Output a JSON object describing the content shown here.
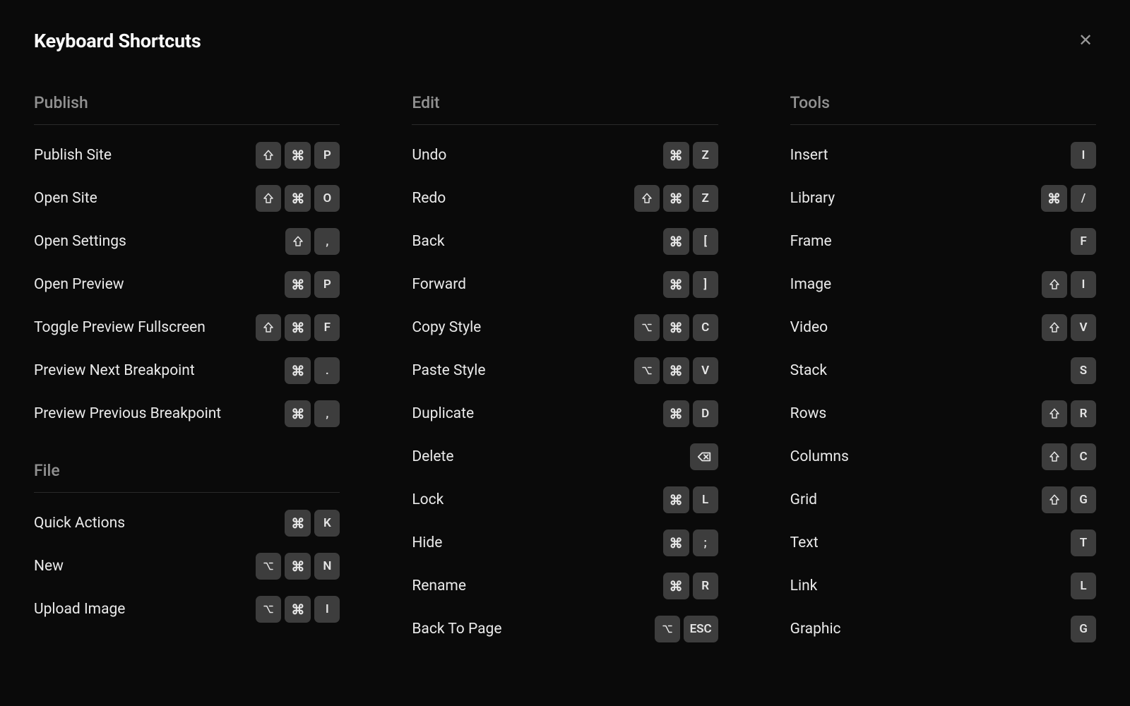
{
  "title": "Keyboard Shortcuts",
  "symbols": {
    "shift": "⇧",
    "cmd": "⌘",
    "option": "⌥"
  },
  "columns": [
    {
      "sections": [
        {
          "title": "Publish",
          "items": [
            {
              "label": "Publish Site",
              "keys": [
                "shift",
                "cmd",
                "P"
              ]
            },
            {
              "label": "Open Site",
              "keys": [
                "shift",
                "cmd",
                "O"
              ]
            },
            {
              "label": "Open Settings",
              "keys": [
                "shift",
                ","
              ]
            },
            {
              "label": "Open Preview",
              "keys": [
                "cmd",
                "P"
              ]
            },
            {
              "label": "Toggle Preview Fullscreen",
              "keys": [
                "shift",
                "cmd",
                "F"
              ]
            },
            {
              "label": "Preview Next Breakpoint",
              "keys": [
                "cmd",
                "."
              ]
            },
            {
              "label": "Preview Previous Breakpoint",
              "keys": [
                "cmd",
                ","
              ]
            }
          ]
        },
        {
          "title": "File",
          "items": [
            {
              "label": "Quick Actions",
              "keys": [
                "cmd",
                "K"
              ]
            },
            {
              "label": "New",
              "keys": [
                "option",
                "cmd",
                "N"
              ]
            },
            {
              "label": "Upload Image",
              "keys": [
                "option",
                "cmd",
                "I"
              ]
            }
          ]
        }
      ]
    },
    {
      "sections": [
        {
          "title": "Edit",
          "items": [
            {
              "label": "Undo",
              "keys": [
                "cmd",
                "Z"
              ]
            },
            {
              "label": "Redo",
              "keys": [
                "shift",
                "cmd",
                "Z"
              ]
            },
            {
              "label": "Back",
              "keys": [
                "cmd",
                "["
              ]
            },
            {
              "label": "Forward",
              "keys": [
                "cmd",
                "]"
              ]
            },
            {
              "label": "Copy Style",
              "keys": [
                "option",
                "cmd",
                "C"
              ]
            },
            {
              "label": "Paste Style",
              "keys": [
                "option",
                "cmd",
                "V"
              ]
            },
            {
              "label": "Duplicate",
              "keys": [
                "cmd",
                "D"
              ]
            },
            {
              "label": "Delete",
              "keys": [
                "backspace"
              ]
            },
            {
              "label": "Lock",
              "keys": [
                "cmd",
                "L"
              ]
            },
            {
              "label": "Hide",
              "keys": [
                "cmd",
                ";"
              ]
            },
            {
              "label": "Rename",
              "keys": [
                "cmd",
                "R"
              ]
            },
            {
              "label": "Back To Page",
              "keys": [
                "option",
                "ESC"
              ]
            }
          ]
        }
      ]
    },
    {
      "sections": [
        {
          "title": "Tools",
          "items": [
            {
              "label": "Insert",
              "keys": [
                "I"
              ]
            },
            {
              "label": "Library",
              "keys": [
                "cmd",
                "/"
              ]
            },
            {
              "label": "Frame",
              "keys": [
                "F"
              ]
            },
            {
              "label": "Image",
              "keys": [
                "shift",
                "I"
              ]
            },
            {
              "label": "Video",
              "keys": [
                "shift",
                "V"
              ]
            },
            {
              "label": "Stack",
              "keys": [
                "S"
              ]
            },
            {
              "label": "Rows",
              "keys": [
                "shift",
                "R"
              ]
            },
            {
              "label": "Columns",
              "keys": [
                "shift",
                "C"
              ]
            },
            {
              "label": "Grid",
              "keys": [
                "shift",
                "G"
              ]
            },
            {
              "label": "Text",
              "keys": [
                "T"
              ]
            },
            {
              "label": "Link",
              "keys": [
                "L"
              ]
            },
            {
              "label": "Graphic",
              "keys": [
                "G"
              ]
            }
          ]
        }
      ]
    }
  ]
}
